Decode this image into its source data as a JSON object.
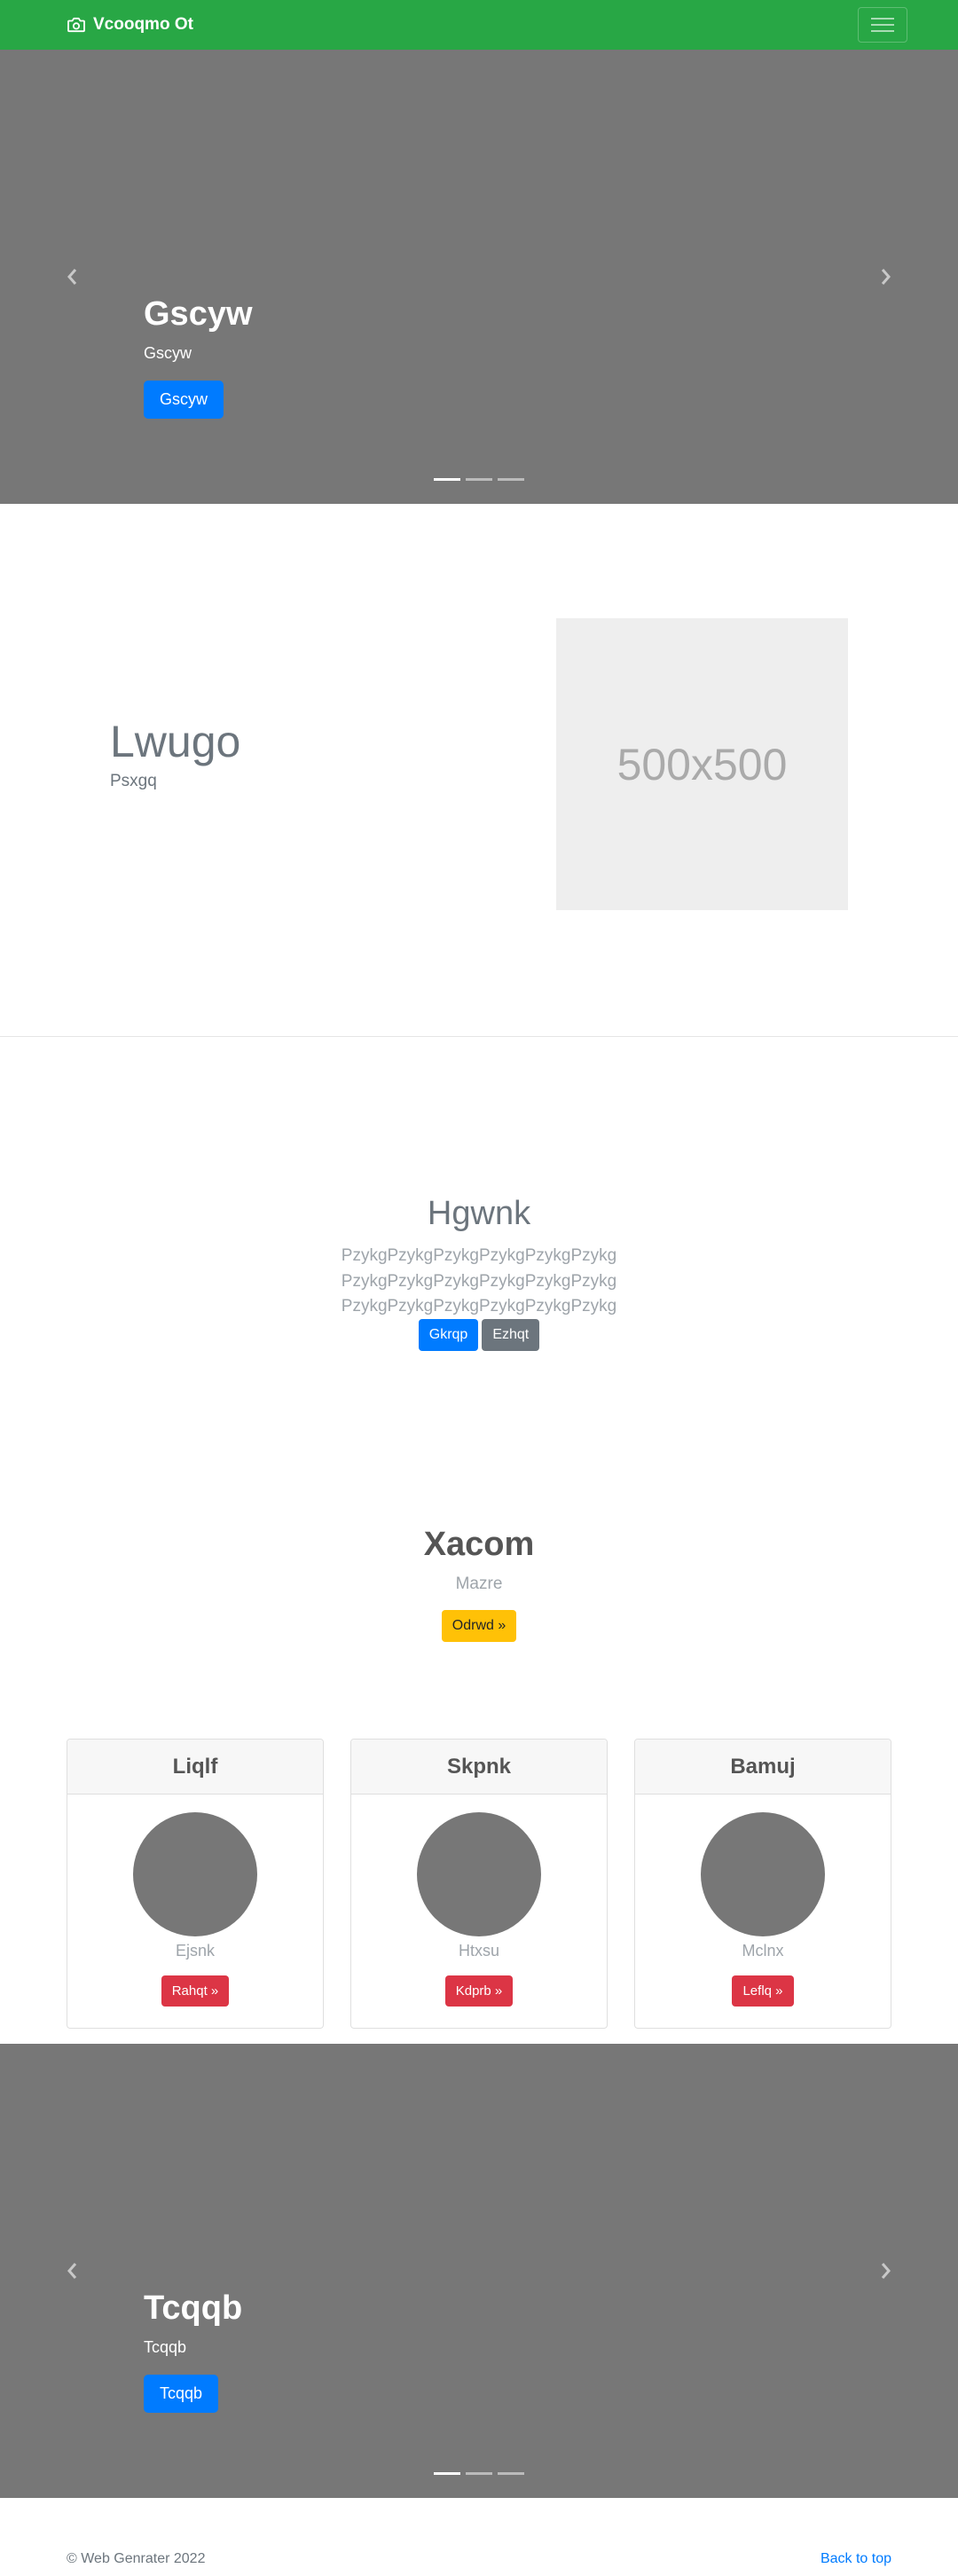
{
  "navbar": {
    "brand": "Vcooqmo Ot",
    "brand_icon": "camera-icon",
    "toggler_icon": "hamburger-icon",
    "bg_color": "#28a745"
  },
  "carousel_top": {
    "title": "Gscyw",
    "subtitle": "Gscyw",
    "button": "Gscyw",
    "slides": 3,
    "active_slide": 1
  },
  "feature": {
    "heading": "Lwugo",
    "text": "Psxgq",
    "image_label": "500x500"
  },
  "jumbotron": {
    "heading": "Hgwnk",
    "text": "PzykgPzykgPzykgPzykgPzykgPzykg PzykgPzykgPzykgPzykgPzykgPzykg PzykgPzykgPzykgPzykgPzykgPzykg",
    "primary_button": "Gkrqp",
    "secondary_button": "Ezhqt"
  },
  "section": {
    "heading": "Xacom",
    "text": "Mazre",
    "button": "Odrwd »"
  },
  "cards": [
    {
      "header": "Liqlf",
      "name": "Ejsnk",
      "button": "Rahqt »"
    },
    {
      "header": "Skpnk",
      "name": "Htxsu",
      "button": "Kdprb »"
    },
    {
      "header": "Bamuj",
      "name": "Mclnx",
      "button": "Leflq »"
    }
  ],
  "carousel_bottom": {
    "title": "Tcqqb",
    "subtitle": "Tcqqb",
    "button": "Tcqqb",
    "slides": 3,
    "active_slide": 1
  },
  "footer": {
    "copyright": "© Web Genrater 2022",
    "back_to_top": "Back to top"
  }
}
